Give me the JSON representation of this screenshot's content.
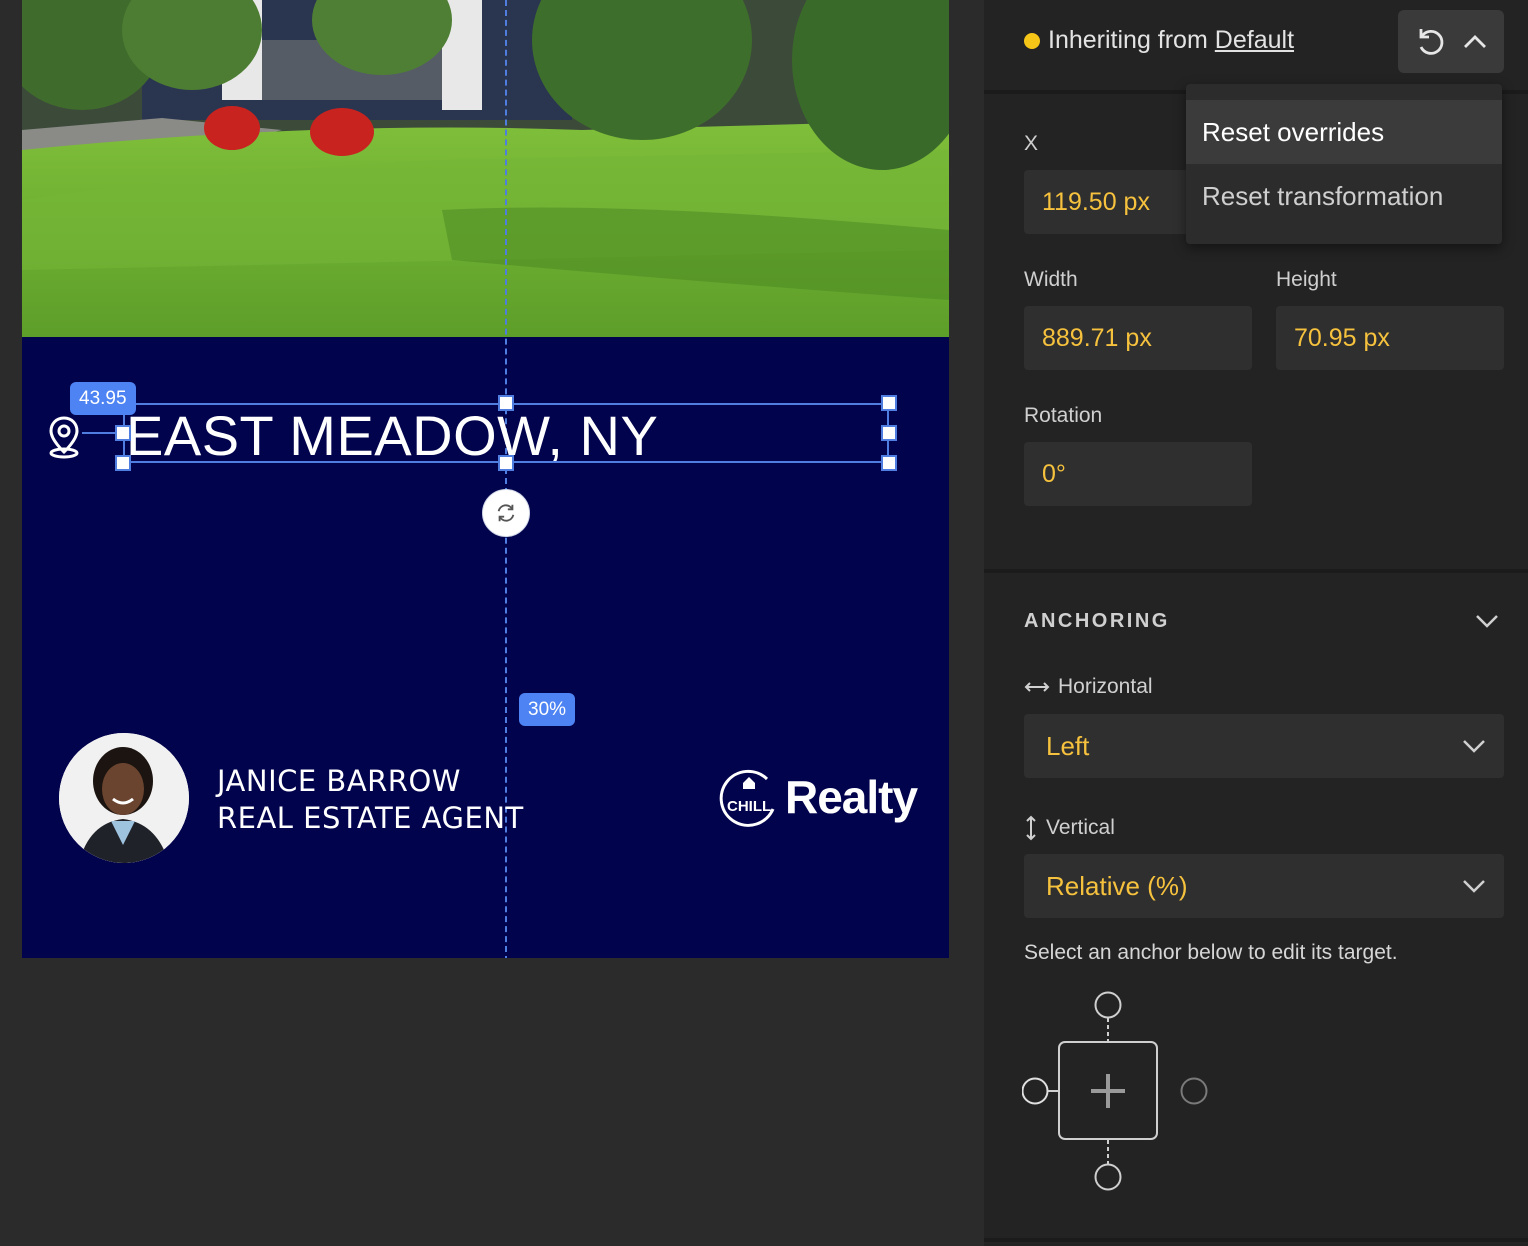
{
  "canvas": {
    "headline": "EAST MEADOW, NY",
    "badge_left": "43.95",
    "badge_percent": "30%",
    "agent_name": "JANICE BARROW",
    "agent_title": "REAL ESTATE AGENT",
    "logo_small": "CHILL",
    "logo_word": "Realty"
  },
  "panel": {
    "inherit_prefix": "Inheriting from",
    "inherit_link": "Default",
    "menu": [
      "Reset overrides",
      "Reset transformation"
    ],
    "fields": {
      "x_label": "X",
      "x_value": "119.50 px",
      "width_label": "Width",
      "width_value": "889.71 px",
      "height_label": "Height",
      "height_value": "70.95 px",
      "rotation_label": "Rotation",
      "rotation_value": "0°"
    },
    "anchoring": {
      "title": "ANCHORING",
      "horizontal_label": "Horizontal",
      "horizontal_value": "Left",
      "vertical_label": "Vertical",
      "vertical_value": "Relative (%)",
      "hint": "Select an anchor below to edit its target."
    }
  },
  "colors": {
    "canvas_bg": "#02034d",
    "accent_blue": "#4d83f2",
    "value_yellow": "#f6c23e",
    "status_dot": "#f5c518"
  }
}
